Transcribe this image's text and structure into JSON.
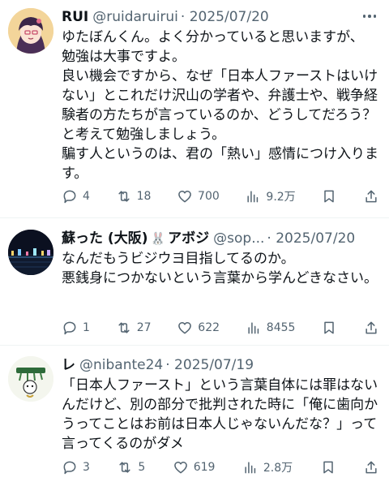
{
  "tweets": [
    {
      "name": "RUI",
      "handle": "@ruidaruirui",
      "date": "· 2025/07/20",
      "text": "ゆたぼんくん。よく分かっていると思いますが、\n勉強は大事ですよ。\n良い機会ですから、なぜ「日本人ファーストはいけない」とこれだけ沢山の学者や、弁護士や、戦争経験者の方たちが言っているのか、どうしてだろう？と考えて勉強しましょう。\n騙す人というのは、君の「熱い」感情につけ入ります。",
      "replies": "4",
      "retweets": "18",
      "likes": "700",
      "views": "9.2万"
    },
    {
      "name": "蘇った (大阪)",
      "name_suffix": "🐰",
      "name_tail": "アボジ",
      "handle": "@sop...",
      "date": "· 2025/07/20",
      "text": "なんだもうビジウヨ目指してるのか。\n悪銭身につかないという言葉から学んどきなさい。",
      "replies": "1",
      "retweets": "27",
      "likes": "622",
      "views": "8455"
    },
    {
      "name": "レ",
      "handle": "@nibante24",
      "date": "· 2025/07/19",
      "text": "「日本人ファースト」という言葉自体には罪はないんだけど、別の部分で批判された時に「俺に歯向かうってことはお前は日本人じゃないんだな？」って言ってくるのがダメ",
      "replies": "3",
      "retweets": "5",
      "likes": "619",
      "views": "2.8万"
    }
  ],
  "icons": [
    "reply-icon",
    "retweet-icon",
    "like-icon",
    "views-icon",
    "bookmark-icon",
    "share-icon",
    "more-icon"
  ]
}
